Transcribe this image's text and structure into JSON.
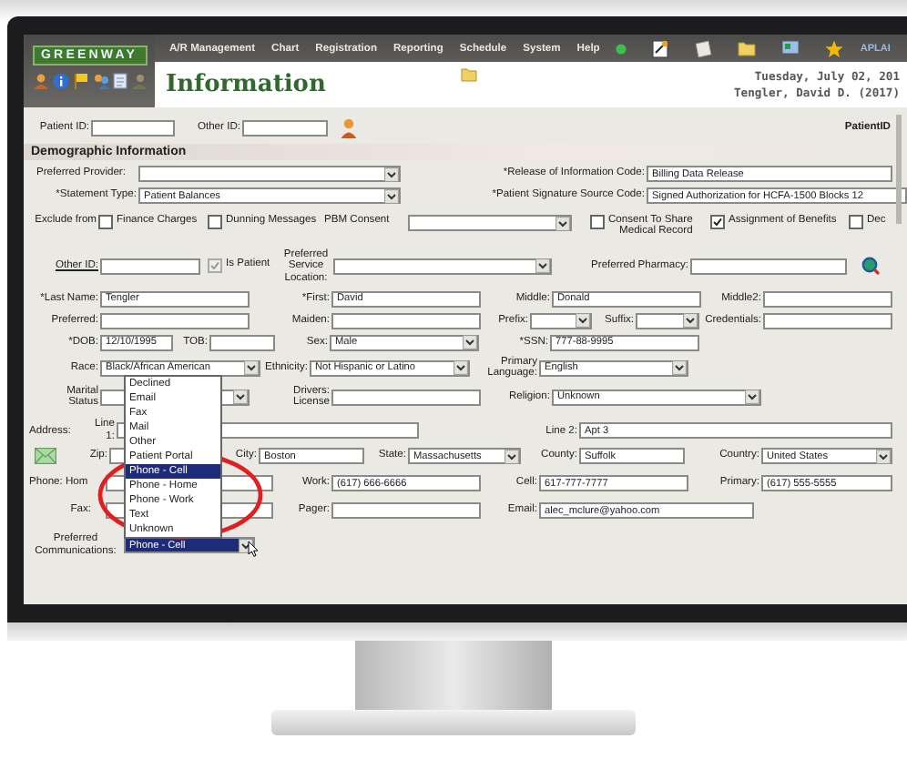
{
  "app": {
    "logo": "GREENWAY",
    "menu": [
      "A/R Management",
      "Chart",
      "Registration",
      "Reporting",
      "Schedule",
      "System",
      "Help"
    ],
    "user_tag": "APLAI",
    "title": "Information",
    "date": "Tuesday, July 02, 201",
    "patient": "Tengler, David D. (2017)"
  },
  "top_row": {
    "items": [
      {
        "kind": "label",
        "text": "Patient ID:"
      },
      {
        "kind": "field"
      },
      {
        "kind": "label",
        "text": "Other ID:"
      },
      {
        "kind": "field"
      },
      {
        "kind": "person_button"
      },
      {
        "kind": "label",
        "text": "PatientID"
      }
    ]
  },
  "section_title": "Demographic Information",
  "form": {
    "rows": [
      {
        "items": [
          {
            "kind": "label",
            "text": "Preferred Provider:"
          },
          {
            "kind": "select"
          },
          {
            "kind": "label",
            "text": "*Release of Information Code:"
          },
          {
            "kind": "field",
            "value": "Billing Data Release"
          }
        ]
      },
      {
        "items": [
          {
            "kind": "label",
            "text": "*Statement Type:"
          },
          {
            "kind": "select",
            "value": "Patient Balances"
          },
          {
            "kind": "label",
            "text": "*Patient Signature Source Code:"
          },
          {
            "kind": "field",
            "value": "Signed Authorization for HCFA-1500 Blocks 12"
          }
        ]
      },
      {
        "items": [
          {
            "kind": "label",
            "text": "Exclude from"
          },
          {
            "kind": "checkbox",
            "label": "Finance Charges",
            "checked": false,
            "disabled": false
          },
          {
            "kind": "checkbox",
            "label": "Dunning Messages",
            "checked": false,
            "disabled": false
          },
          {
            "kind": "label",
            "text": "PBM Consent"
          },
          {
            "kind": "select"
          },
          {
            "kind": "checkbox",
            "label": "Consent To Share\nMedical Record",
            "checked": false,
            "disabled": false
          },
          {
            "kind": "checkbox",
            "label": "Assignment of Benefits",
            "checked": true,
            "disabled": false
          },
          {
            "kind": "checkbox",
            "label": "Dec",
            "checked": false,
            "disabled": false
          }
        ]
      },
      {
        "items": [
          {
            "kind": "link",
            "text": "Other ID:"
          },
          {
            "kind": "field"
          },
          {
            "kind": "checkbox",
            "label": "Is Patient",
            "checked": true,
            "disabled": true
          },
          {
            "kind": "label",
            "text": "Preferred\nService\nLocation:"
          },
          {
            "kind": "select"
          },
          {
            "kind": "label",
            "text": "Preferred Pharmacy:"
          },
          {
            "kind": "field"
          },
          {
            "kind": "search_button"
          }
        ]
      },
      {
        "items": [
          {
            "kind": "label",
            "text": "*Last Name:"
          },
          {
            "kind": "field",
            "value": "Tengler"
          },
          {
            "kind": "label",
            "text": "*First:"
          },
          {
            "kind": "field",
            "value": "David"
          },
          {
            "kind": "label",
            "text": "Middle:"
          },
          {
            "kind": "field",
            "value": "Donald"
          },
          {
            "kind": "label",
            "text": "Middle2:"
          },
          {
            "kind": "field"
          }
        ]
      },
      {
        "items": [
          {
            "kind": "label",
            "text": "Preferred:"
          },
          {
            "kind": "field"
          },
          {
            "kind": "label",
            "text": "Maiden:"
          },
          {
            "kind": "field"
          },
          {
            "kind": "label",
            "text": "Prefix:"
          },
          {
            "kind": "select"
          },
          {
            "kind": "label",
            "text": "Suffix:"
          },
          {
            "kind": "select"
          },
          {
            "kind": "label",
            "text": "Credentials:"
          },
          {
            "kind": "field"
          }
        ]
      },
      {
        "items": [
          {
            "kind": "label",
            "text": "*DOB:"
          },
          {
            "kind": "field",
            "value": "12/10/1995"
          },
          {
            "kind": "label",
            "text": "TOB:"
          },
          {
            "kind": "field"
          },
          {
            "kind": "label",
            "text": "Sex:"
          },
          {
            "kind": "select",
            "value": "Male"
          },
          {
            "kind": "label",
            "text": "*SSN:"
          },
          {
            "kind": "field",
            "value": "777-88-9995"
          }
        ]
      },
      {
        "items": [
          {
            "kind": "label",
            "text": "Race:"
          },
          {
            "kind": "select",
            "value": "Black/African American"
          },
          {
            "kind": "label",
            "text": "Ethnicity:"
          },
          {
            "kind": "select",
            "value": "Not Hispanic or Latino"
          },
          {
            "kind": "label",
            "text": "Primary\nLanguage:"
          },
          {
            "kind": "select",
            "value": "English"
          }
        ]
      },
      {
        "items": [
          {
            "kind": "label",
            "text": "Marital\nStatus"
          },
          {
            "kind": "select"
          },
          {
            "kind": "label",
            "text": "Drivers:\nLicense"
          },
          {
            "kind": "field"
          },
          {
            "kind": "label",
            "text": "Religion:"
          },
          {
            "kind": "select",
            "value": "Unknown"
          }
        ]
      },
      {
        "items": [
          {
            "kind": "label",
            "text": "Address:"
          },
          {
            "kind": "label",
            "text": "Line\n1:"
          },
          {
            "kind": "field"
          },
          {
            "kind": "label",
            "text": "Line 2:"
          },
          {
            "kind": "field",
            "value": "Apt 3"
          }
        ]
      },
      {
        "items": [
          {
            "kind": "mail_button"
          },
          {
            "kind": "label",
            "text": "Zip:"
          },
          {
            "kind": "field"
          },
          {
            "kind": "label",
            "text": "City:"
          },
          {
            "kind": "field",
            "value": "Boston"
          },
          {
            "kind": "label",
            "text": "State:"
          },
          {
            "kind": "select",
            "value": "Massachusetts"
          },
          {
            "kind": "label",
            "text": "County:"
          },
          {
            "kind": "field",
            "value": "Suffolk"
          },
          {
            "kind": "label",
            "text": "Country:"
          },
          {
            "kind": "select",
            "value": "United States"
          }
        ]
      },
      {
        "items": [
          {
            "kind": "label",
            "text": "Phone: Hom"
          },
          {
            "kind": "field"
          },
          {
            "kind": "label",
            "text": "Work:"
          },
          {
            "kind": "field",
            "value": "(617) 666-6666"
          },
          {
            "kind": "label",
            "text": "Cell:"
          },
          {
            "kind": "field",
            "value": "617-777-7777"
          },
          {
            "kind": "label",
            "text": "Primary:"
          },
          {
            "kind": "field",
            "value": "(617) 555-5555"
          }
        ]
      },
      {
        "items": [
          {
            "kind": "label",
            "text": "Fax:"
          },
          {
            "kind": "field"
          },
          {
            "kind": "label",
            "text": "Pager:"
          },
          {
            "kind": "field"
          },
          {
            "kind": "label",
            "text": "Email:"
          },
          {
            "kind": "field",
            "value": "alec_mclure@yahoo.com"
          }
        ]
      }
    ]
  },
  "communications": {
    "label": "Preferred\nCommunications:",
    "value": "Phone - Cell",
    "options": [
      {
        "label": "Declined",
        "selected": false
      },
      {
        "label": "Email",
        "selected": false
      },
      {
        "label": "Fax",
        "selected": false
      },
      {
        "label": "Mail",
        "selected": false
      },
      {
        "label": "Other",
        "selected": false
      },
      {
        "label": "Patient Portal",
        "selected": false
      },
      {
        "label": "Phone - Cell",
        "selected": true
      },
      {
        "label": "Phone - Home",
        "selected": false
      },
      {
        "label": "Phone - Work",
        "selected": false
      },
      {
        "label": "Text",
        "selected": false
      },
      {
        "label": "Unknown",
        "selected": false
      }
    ]
  }
}
